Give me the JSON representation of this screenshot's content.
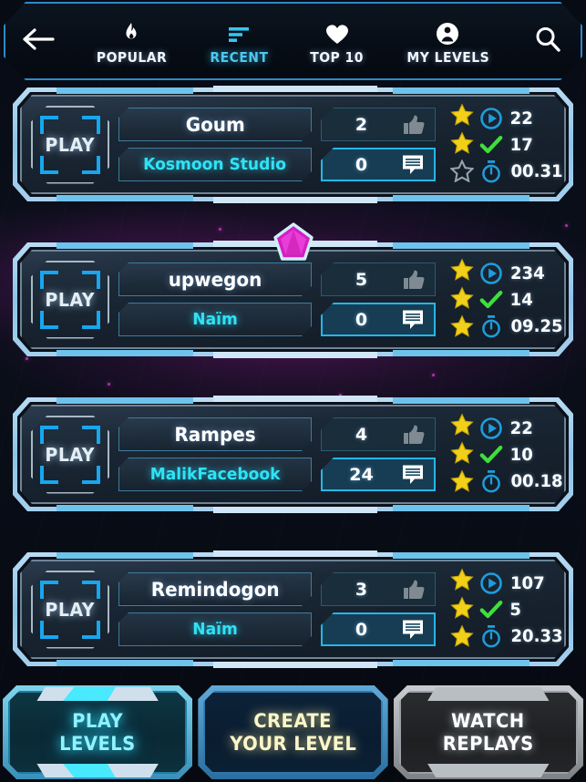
{
  "header": {
    "back_icon": "back-arrow-icon",
    "search_icon": "search-icon",
    "tabs": [
      {
        "label": "POPULAR",
        "icon": "flame-icon",
        "active": false
      },
      {
        "label": "RECENT",
        "icon": "bars-icon",
        "active": true
      },
      {
        "label": "TOP 10",
        "icon": "heart-icon",
        "active": false
      },
      {
        "label": "MY LEVELS",
        "icon": "person-icon",
        "active": false
      }
    ]
  },
  "levels": [
    {
      "play_label": "PLAY",
      "name": "Goum",
      "author": "Kosmoon Studio",
      "likes": "2",
      "comments": "0",
      "stars_filled": 2,
      "stars_total": 3,
      "plays": "22",
      "completions": "17",
      "time": "00.31",
      "featured": false
    },
    {
      "play_label": "PLAY",
      "name": "upwegon",
      "author": "Naïm",
      "likes": "5",
      "comments": "0",
      "stars_filled": 3,
      "stars_total": 3,
      "plays": "234",
      "completions": "14",
      "time": "09.25",
      "featured": true,
      "badge_icon": "pentagon-gem-icon"
    },
    {
      "play_label": "PLAY",
      "name": "Rampes",
      "author": "MalikFacebook",
      "likes": "4",
      "comments": "24",
      "stars_filled": 3,
      "stars_total": 3,
      "plays": "22",
      "completions": "10",
      "time": "00.18",
      "featured": false
    },
    {
      "play_label": "PLAY",
      "name": "Remindogon",
      "author": "Naïm",
      "likes": "3",
      "comments": "0",
      "stars_filled": 3,
      "stars_total": 3,
      "plays": "107",
      "completions": "5",
      "time": "20.33",
      "featured": false
    }
  ],
  "stat_icons": {
    "likes": "thumbs-up-icon",
    "comments": "comment-icon",
    "plays": "play-circle-icon",
    "completions": "check-icon",
    "time": "stopwatch-icon"
  },
  "bottom_nav": [
    {
      "line1": "PLAY",
      "line2": "LEVELS",
      "state": "active"
    },
    {
      "line1": "CREATE",
      "line2": "YOUR LEVEL",
      "state": "normal"
    },
    {
      "line1": "WATCH",
      "line2": "REPLAYS",
      "state": "inactive"
    }
  ],
  "colors": {
    "accent_cyan": "#2fe3f5",
    "frame_blue": "#a5d0ee",
    "star_gold": "#f2d01a",
    "check_green": "#3ee03a",
    "gem_magenta": "#e02ad0",
    "create_yellow": "#fbf6c8"
  }
}
